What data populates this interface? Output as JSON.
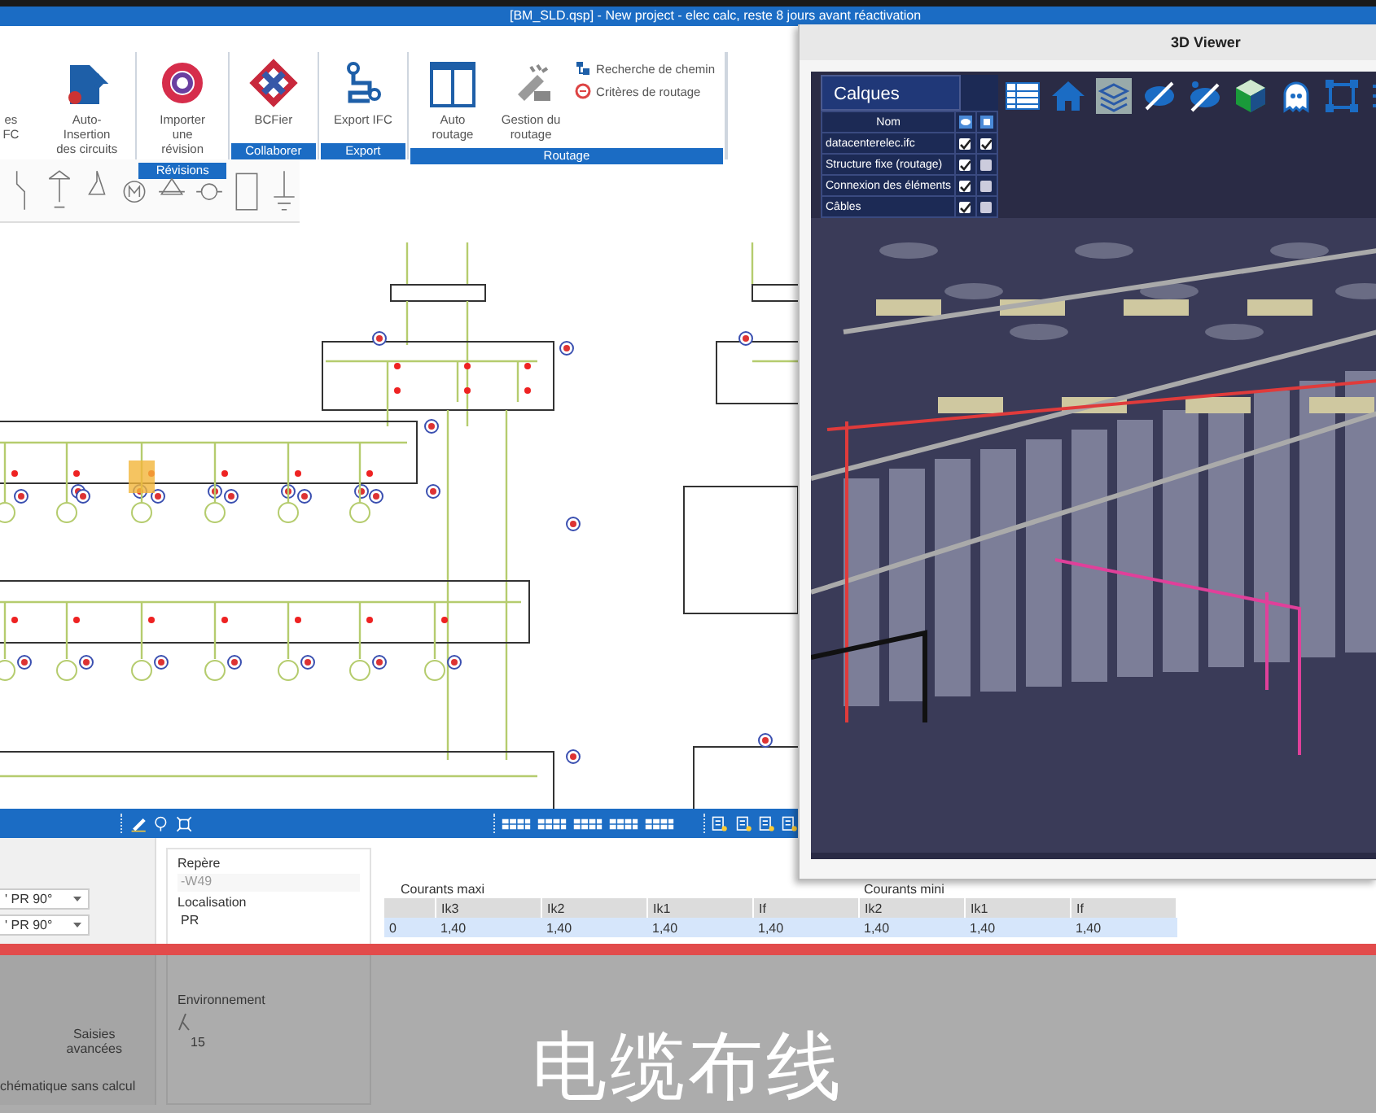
{
  "window": {
    "title": "[BM_SLD.qsp] - New project - elec calc, reste 8 jours avant réactivation"
  },
  "ribbon": {
    "groups": [
      {
        "buttons": [
          {
            "label": "es\nFC",
            "kind": "large"
          },
          {
            "label": "Auto-Insertion\ndes circuits",
            "kind": "large"
          }
        ]
      },
      {
        "label": "Révisions",
        "buttons": [
          {
            "label": "Importer une\nrévision",
            "kind": "large"
          }
        ]
      },
      {
        "label": "Collaborer",
        "buttons": [
          {
            "label": "BCFier",
            "kind": "large"
          }
        ]
      },
      {
        "label": "Export",
        "buttons": [
          {
            "label": "Export IFC",
            "kind": "large"
          }
        ]
      },
      {
        "label": "Routage",
        "buttons": [
          {
            "label": "Auto routage",
            "kind": "large"
          },
          {
            "label": "Gestion du\nroutage",
            "kind": "large"
          },
          {
            "label": "Recherche de chemin",
            "kind": "small"
          },
          {
            "label": "Critères de routage",
            "kind": "small"
          }
        ]
      }
    ]
  },
  "viewer": {
    "title": "3D Viewer",
    "layers": {
      "title": "Calques",
      "column": "Nom",
      "rows": [
        {
          "name": "datacenterelec.ifc",
          "visible": true,
          "transparent": true
        },
        {
          "name": "Structure fixe (routage)",
          "visible": true,
          "transparent": false
        },
        {
          "name": "Connexion des éléments",
          "visible": true,
          "transparent": false
        },
        {
          "name": "Câbles",
          "visible": true,
          "transparent": false
        }
      ]
    }
  },
  "properties": {
    "dropdowns": [
      {
        "value": "' PR 90°"
      },
      {
        "value": "' PR 90°"
      }
    ],
    "advanced_button": "Saisies\navancées",
    "mode_label": "chématique sans calcul",
    "fields": [
      {
        "label": "Repère",
        "value": "-W49",
        "disabled": true
      },
      {
        "label": "Localisation",
        "value": "PR",
        "disabled": false
      }
    ],
    "environment": {
      "label": "Environnement",
      "value": "15"
    }
  },
  "currents_table": {
    "groups": [
      "Courants maxi",
      "Courants mini"
    ],
    "columns": [
      "",
      "Ik3",
      "Ik2",
      "Ik1",
      "If",
      "Ik2",
      "Ik1",
      "If"
    ],
    "rows": [
      {
        "cells": [
          "0",
          "1,40",
          "1,40",
          "1,40",
          "1,40",
          "1,40",
          "1,40",
          "1,40"
        ],
        "selected": true
      }
    ]
  },
  "subtitle": "电缆布线"
}
